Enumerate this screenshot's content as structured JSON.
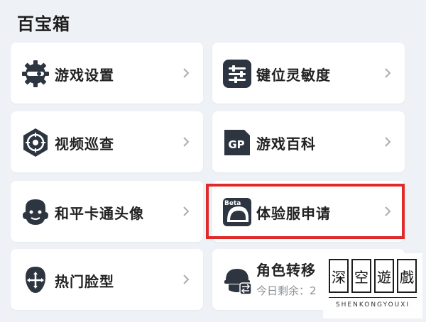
{
  "section": {
    "title": "百宝箱"
  },
  "items": [
    {
      "label": "游戏设置",
      "icon": "gear-icon"
    },
    {
      "label": "键位灵敏度",
      "icon": "sliders-icon"
    },
    {
      "label": "视频巡查",
      "icon": "target-icon"
    },
    {
      "label": "游戏百科",
      "icon": "gp-book-icon"
    },
    {
      "label": "和平卡通头像",
      "icon": "cartoon-avatar-icon"
    },
    {
      "label": "体验服申请",
      "icon": "beta-helmet-icon",
      "badge": "Beta"
    },
    {
      "label": "热门脸型",
      "icon": "face-shape-icon"
    },
    {
      "label": "角色转移",
      "icon": "character-transfer-icon",
      "sub": "今日剩余：2"
    }
  ],
  "watermark": {
    "chars": [
      "深",
      "空",
      "遊",
      "戲"
    ],
    "text": "SHENKONGYOUXI"
  },
  "colors": {
    "highlight": "#e02a2a",
    "icon_dark": "#2c3540",
    "background": "#eef1f5"
  }
}
